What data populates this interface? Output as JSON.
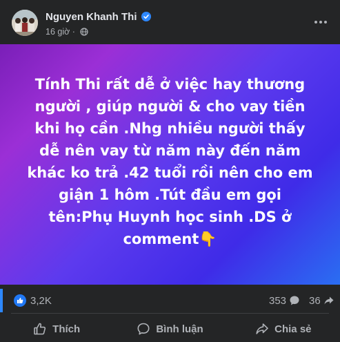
{
  "post": {
    "author": "Nguyen Khanh Thi",
    "time": "16 giờ",
    "text": "Tính Thi rất dễ ở việc hay thương người , giúp người & cho vay tiền khi họ cần .Nhg nhiều người thấy dễ nên vay từ năm này đến năm khác ko trả .42 tuổi rồi nên cho em giận 1 hôm .Tút đầu em gọi tên:Phụ Huynh học sinh .DS ở comment👇",
    "background_gradient": [
      "#7a1fb8",
      "#5d3aee",
      "#2a6ef2"
    ]
  },
  "stats": {
    "likes": "3,2K",
    "comments": "353",
    "shares": "36"
  },
  "actions": {
    "like": "Thích",
    "comment": "Bình luận",
    "share": "Chia sẻ"
  },
  "colors": {
    "card_bg": "#242526",
    "accent": "#2d88ff",
    "text_primary": "#e4e6eb",
    "text_secondary": "#b0b3b8"
  }
}
